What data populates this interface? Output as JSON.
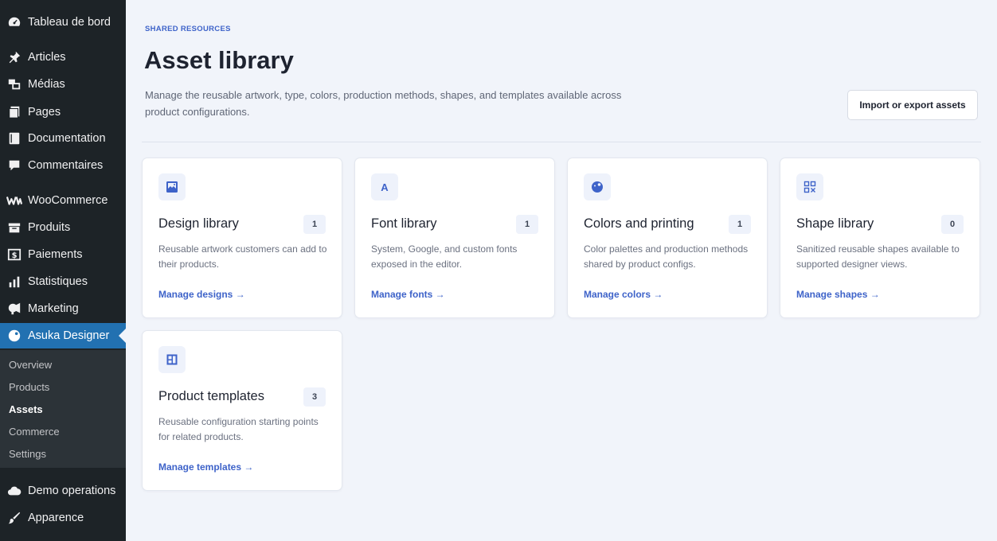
{
  "sidebar": {
    "items": [
      {
        "label": "Tableau de bord",
        "icon": "dashboard-icon"
      },
      {
        "label": "Articles",
        "icon": "pin-icon"
      },
      {
        "label": "Médias",
        "icon": "media-icon"
      },
      {
        "label": "Pages",
        "icon": "pages-icon"
      },
      {
        "label": "Documentation",
        "icon": "book-icon"
      },
      {
        "label": "Commentaires",
        "icon": "comment-icon"
      },
      {
        "label": "WooCommerce",
        "icon": "woocommerce-icon"
      },
      {
        "label": "Produits",
        "icon": "archive-icon"
      },
      {
        "label": "Paiements",
        "icon": "dollar-icon"
      },
      {
        "label": "Statistiques",
        "icon": "bar-chart-icon"
      },
      {
        "label": "Marketing",
        "icon": "megaphone-icon"
      },
      {
        "label": "Asuka Designer",
        "icon": "palette-icon"
      },
      {
        "label": "Demo operations",
        "icon": "cloud-icon"
      },
      {
        "label": "Apparence",
        "icon": "brush-icon"
      }
    ],
    "submenu": [
      "Overview",
      "Products",
      "Assets",
      "Commerce",
      "Settings"
    ],
    "active_item": "Asuka Designer",
    "current_submenu": "Assets"
  },
  "header": {
    "eyebrow": "SHARED RESOURCES",
    "title": "Asset library",
    "description": "Manage the reusable artwork, type, colors, production methods, shapes, and templates available across product configurations.",
    "import_button": "Import or export assets"
  },
  "cards": [
    {
      "title": "Design library",
      "count": "1",
      "icon": "image-icon",
      "description": "Reusable artwork customers can add to their products.",
      "link": "Manage designs →"
    },
    {
      "title": "Font library",
      "count": "1",
      "icon": "font-icon",
      "icon_glyph": "A",
      "description": "System, Google, and custom fonts exposed in the editor.",
      "link": "Manage fonts →"
    },
    {
      "title": "Colors and printing",
      "count": "1",
      "icon": "palette-icon",
      "description": "Color palettes and production methods shared by product configs.",
      "link": "Manage colors →"
    },
    {
      "title": "Shape library",
      "count": "0",
      "icon": "shapes-grid-icon",
      "description": "Sanitized reusable shapes available to supported designer views.",
      "link": "Manage shapes →"
    },
    {
      "title": "Product templates",
      "count": "3",
      "icon": "template-icon",
      "description": "Reusable configuration starting points for related products.",
      "link": "Manage templates →"
    }
  ],
  "colors": {
    "sidebar_bg": "#1d2327",
    "active_bg": "#2271b1",
    "accent": "#3e63c9",
    "page_bg": "#f1f4fa"
  }
}
